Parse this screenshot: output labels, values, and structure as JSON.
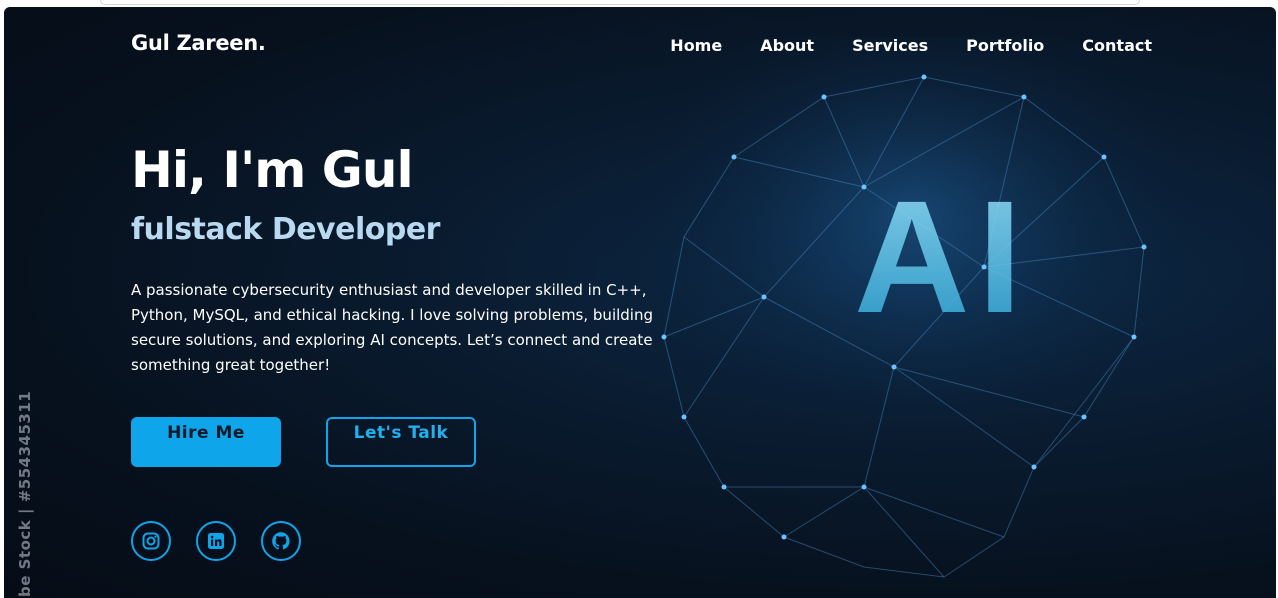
{
  "header": {
    "logo": "Gul Zareen.",
    "nav": [
      "Home",
      "About",
      "Services",
      "Portfolio",
      "Contact"
    ]
  },
  "hero": {
    "title": "Hi, I'm Gul",
    "subtitle": "fulstack Developer",
    "description": "A passionate cybersecurity enthusiast and developer skilled in C++, Python, MySQL, and ethical hacking. I love solving problems, building secure solutions, and exploring AI concepts. Let’s connect and create something great together!",
    "buttons": {
      "hire": "Hire Me",
      "talk": "Let's Talk"
    },
    "art_text": "AI",
    "watermark": "be Stock | #554345311"
  },
  "socials": [
    {
      "icon": "instagram-icon"
    },
    {
      "icon": "linkedin-icon"
    },
    {
      "icon": "github-icon"
    }
  ],
  "colors": {
    "accent": "#0ea5ea",
    "subtitle": "#b9d9f0",
    "background": "#07111e"
  }
}
